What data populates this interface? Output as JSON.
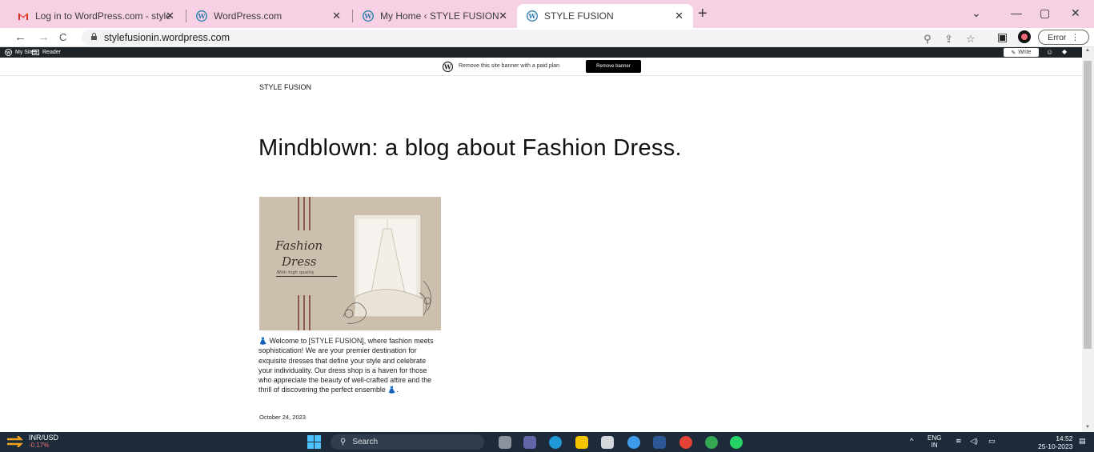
{
  "browser": {
    "tabs": [
      {
        "title": "Log in to WordPress.com - style",
        "icon": "gmail-icon"
      },
      {
        "title": "WordPress.com",
        "icon": "wordpress-icon"
      },
      {
        "title": "My Home ‹ STYLE FUSION — W",
        "icon": "wordpress-icon"
      },
      {
        "title": "STYLE FUSION",
        "icon": "wordpress-icon",
        "active": true
      }
    ],
    "new_tab": "+",
    "window_controls": {
      "dropdown": "⌄",
      "minimize": "—",
      "maximize": "▢",
      "close": "✕"
    },
    "nav": {
      "back": "←",
      "forward": "→",
      "reload": "C"
    },
    "url": "stylefusionin.wordpress.com",
    "toolbar_icons": [
      "zoom-icon",
      "share-icon",
      "star-icon",
      "sidepanel-icon"
    ],
    "error_button": "Error",
    "error_menu": "⋮"
  },
  "admin_bar": {
    "my_sites": "My Sites",
    "reader": "Reader",
    "write": "Write"
  },
  "banner": {
    "text": "Remove this site banner with a paid plan",
    "button": "Remove banner"
  },
  "page": {
    "site_title": "STYLE FUSION",
    "heading": "Mindblown: a blog about Fashion Dress.",
    "post": {
      "image_text": {
        "line1": "Fashion",
        "line2": "Dress",
        "tagline": "With high quality"
      },
      "excerpt": "👗 Welcome to [STYLE FUSION], where fashion meets sophistication! We are your premier destination for exquisite dresses that define your style and celebrate your individuality. Our dress shop is a haven for those who appreciate the beauty of well-crafted attire and the thrill of discovering the perfect ensemble 👗.",
      "date": "October 24, 2023"
    }
  },
  "taskbar": {
    "ticker_label": "INR/USD",
    "ticker_change": "-0.17%",
    "search": "Search",
    "language": "ENG",
    "region": "IN",
    "time": "14:52",
    "date": "25-10-2023"
  },
  "colors": {
    "tabstrip": "#f6d1e3",
    "adminbar": "#1d2327",
    "taskbar": "#1c2a3a",
    "image_bg": "#cdbfae"
  }
}
